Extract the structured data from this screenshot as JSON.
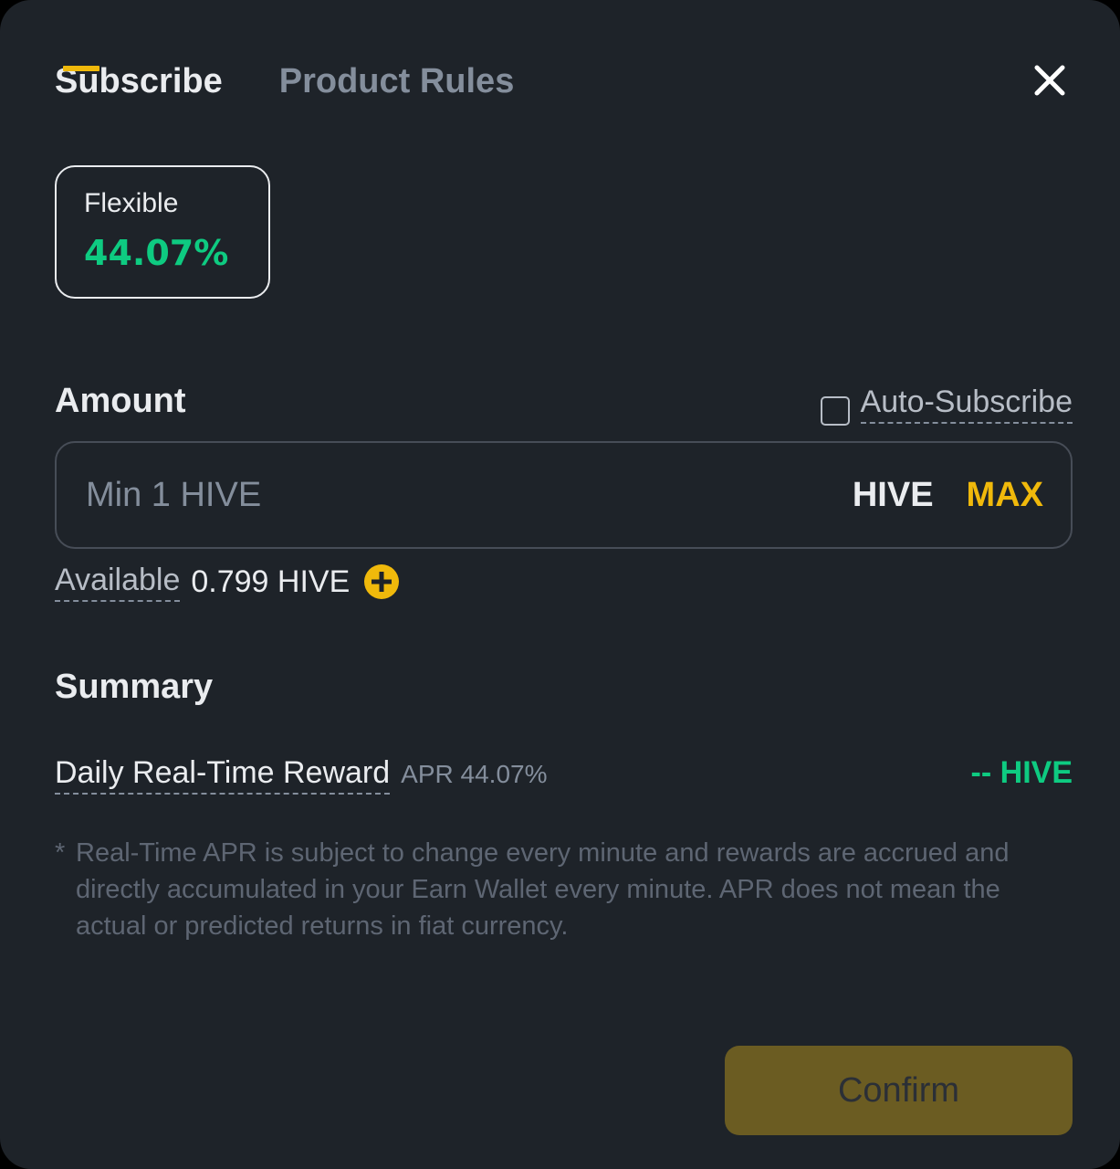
{
  "tabs": [
    {
      "label": "Subscribe"
    },
    {
      "label": "Product Rules"
    }
  ],
  "product": {
    "type": "Flexible",
    "apr": "44.07%"
  },
  "amount": {
    "title": "Amount",
    "auto_subscribe_label": "Auto-Subscribe",
    "placeholder": "Min 1 HIVE",
    "asset": "HIVE",
    "max_label": "MAX",
    "available_label": "Available",
    "available_value": "0.799 HIVE"
  },
  "summary": {
    "title": "Summary",
    "reward_label": "Daily Real-Time Reward",
    "reward_apr": "APR 44.07%",
    "reward_value": "-- HIVE",
    "disclaimer_star": "*",
    "disclaimer": "Real-Time APR is subject to change every minute and rewards are accrued and directly accumulated in your Earn Wallet every minute. APR does not mean the actual or predicted returns in fiat currency."
  },
  "confirm_label": "Confirm",
  "colors": {
    "background": "#1e2329",
    "accent": "#f0b90b",
    "positive": "#0ecb81",
    "text_primary": "#eaecef",
    "text_secondary": "#848e9c",
    "confirm_disabled": "#6b5c22"
  },
  "icons": {
    "close": "close-icon",
    "add": "plus-circle-icon"
  }
}
